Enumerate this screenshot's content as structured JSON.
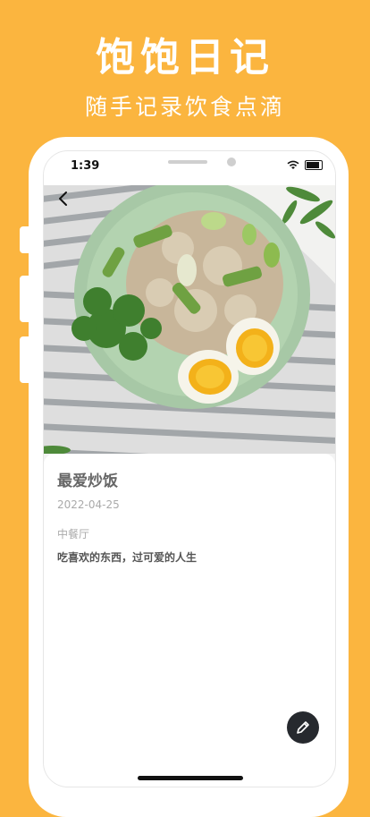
{
  "promo": {
    "title": "饱饱日记",
    "subtitle": "随手记录饮食点滴"
  },
  "status_bar": {
    "time": "1:39"
  },
  "entry": {
    "name": "最爱炒饭",
    "date": "2022-04-25",
    "category": "中餐厅",
    "note": "吃喜欢的东西，过可爱的人生"
  },
  "icons": {
    "back": "chevron-left-icon",
    "edit": "pencil-icon",
    "wifi": "wifi-icon",
    "battery": "battery-icon"
  },
  "colors": {
    "background": "#FBB53F",
    "edit_button": "#26292e"
  }
}
